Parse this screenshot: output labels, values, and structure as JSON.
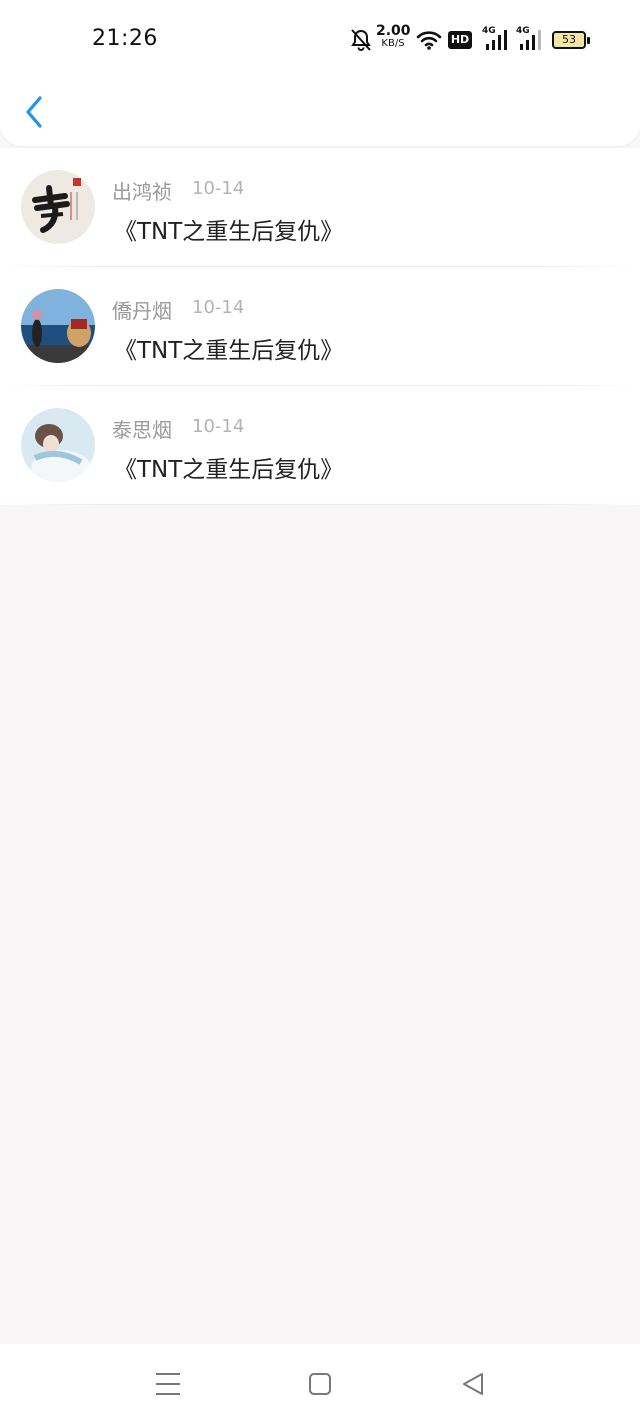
{
  "status_bar": {
    "time": "21:26",
    "speed_value": "2.00",
    "speed_unit": "KB/S",
    "hd_label": "HD",
    "net1": "4G",
    "net2": "4G",
    "battery": "53",
    "icons": [
      "bell-off-icon",
      "wifi-icon",
      "hd-icon",
      "signal-icon",
      "signal-icon",
      "battery-icon"
    ]
  },
  "nav": {
    "back_icon": "chevron-left-icon",
    "accent_color": "#1e96e6"
  },
  "items": [
    {
      "name": "出鸿祯",
      "date": "10-14",
      "title": "《TNT之重生后复仇》"
    },
    {
      "name": "僑丹烟",
      "date": "10-14",
      "title": "《TNT之重生后复仇》"
    },
    {
      "name": "泰思烟",
      "date": "10-14",
      "title": "《TNT之重生后复仇》"
    }
  ],
  "bottom_nav": {
    "icons": [
      "menu-icon",
      "home-square-icon",
      "back-triangle-icon"
    ]
  }
}
